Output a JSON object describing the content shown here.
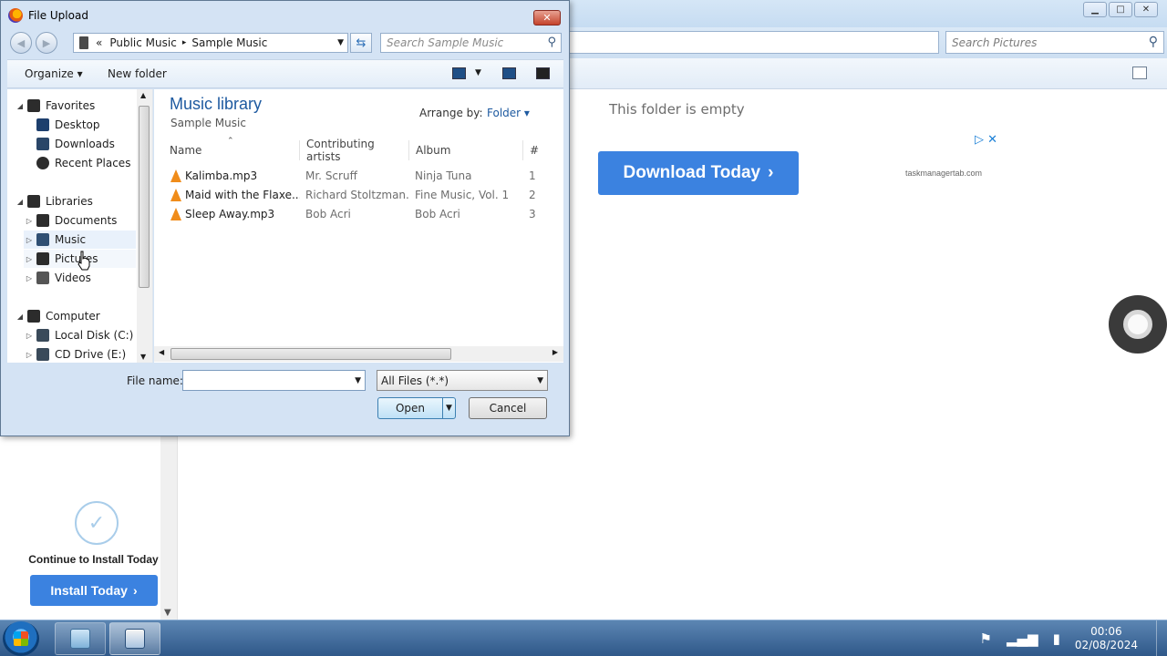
{
  "background": {
    "search_placeholder": "Search Pictures",
    "empty_message": "This folder is empty",
    "ad": {
      "button_label": "Download Today",
      "button_chevron": "›",
      "domain": "taskmanagertab.com",
      "close_glyphs": "▷ ✕"
    },
    "install": {
      "check_glyph": "✓",
      "text": "Continue to Install Today",
      "button_label": "Install Today",
      "button_chevron": "›"
    }
  },
  "dialog": {
    "title": "File Upload",
    "close_glyph": "✕",
    "path": {
      "overflow": "«",
      "crumbs": [
        "Public Music",
        "Sample Music"
      ],
      "separator": "▸"
    },
    "search_placeholder": "Search Sample Music",
    "toolbar": {
      "organize": "Organize ▾",
      "new_folder": "New folder"
    },
    "nav": {
      "items": [
        {
          "label": "Favorites",
          "tri": "◢"
        },
        {
          "label": "Desktop",
          "tri": ""
        },
        {
          "label": "Downloads",
          "tri": ""
        },
        {
          "label": "Recent Places",
          "tri": ""
        },
        {
          "label": "Libraries",
          "tri": "◢"
        },
        {
          "label": "Documents",
          "tri": "▷"
        },
        {
          "label": "Music",
          "tri": "▷"
        },
        {
          "label": "Pictures",
          "tri": "▷"
        },
        {
          "label": "Videos",
          "tri": "▷"
        },
        {
          "label": "Computer",
          "tri": "◢"
        },
        {
          "label": "Local Disk (C:)",
          "tri": "▷"
        },
        {
          "label": "CD Drive (E:)",
          "tri": "▷"
        }
      ]
    },
    "library": {
      "title": "Music library",
      "subtitle": "Sample Music",
      "arrange_label": "Arrange by:",
      "arrange_value": "Folder ▾"
    },
    "columns": [
      "Name",
      "Contributing artists",
      "Album",
      "#"
    ],
    "files": [
      {
        "name": "Kalimba.mp3",
        "artist": "Mr. Scruff",
        "album": "Ninja Tuna",
        "num": "1"
      },
      {
        "name": "Maid with the Flaxe...",
        "artist": "Richard Stoltzman...",
        "album": "Fine Music, Vol. 1",
        "num": "2"
      },
      {
        "name": "Sleep Away.mp3",
        "artist": "Bob Acri",
        "album": "Bob Acri",
        "num": "3"
      }
    ],
    "file_name_label": "File name:",
    "file_name_value": "",
    "filter": "All Files (*.*)",
    "open_label": "Open",
    "cancel_label": "Cancel"
  },
  "taskbar": {
    "time": "00:06",
    "date": "02/08/2024"
  }
}
